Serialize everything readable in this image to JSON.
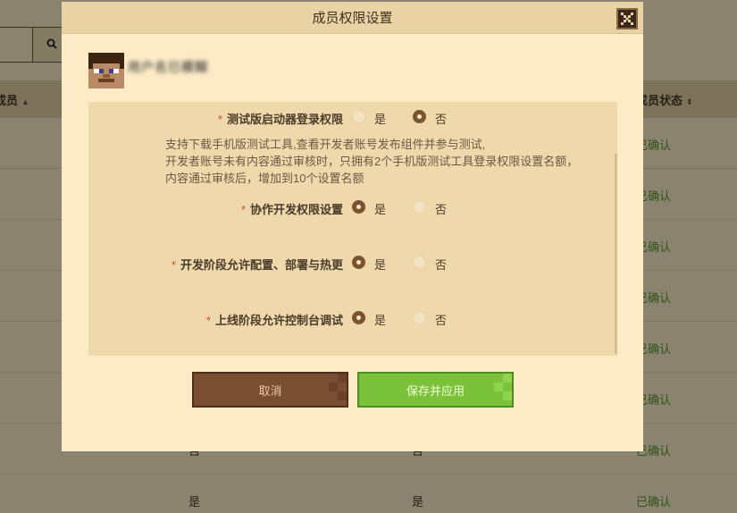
{
  "background": {
    "search_button_icon": "search-icon",
    "header_left": "成员",
    "header_right": "成员状态",
    "rows": [
      {
        "col1": "",
        "col2": "",
        "status": "已确认"
      },
      {
        "col1": "",
        "col2": "",
        "status": "已确认"
      },
      {
        "col1": "",
        "col2": "",
        "status": "已确认"
      },
      {
        "col1": "",
        "col2": "",
        "status": "已确认"
      },
      {
        "col1": "",
        "col2": "",
        "status": "已确认"
      },
      {
        "col1": "",
        "col2": "",
        "status": "已确认"
      },
      {
        "col1": "否",
        "col2": "否",
        "status": "已确认"
      },
      {
        "col1": "是",
        "col2": "是",
        "status": "已确认"
      }
    ]
  },
  "modal": {
    "title": "成员权限设置",
    "close_icon": "close-icon",
    "user": {
      "avatar_icon": "steve-avatar-icon",
      "name": "用户名已模糊"
    },
    "permissions": [
      {
        "required_mark": "*",
        "label": "测试版启动器登录权限",
        "yes_label": "是",
        "no_label": "否",
        "selected": "no",
        "description": [
          "支持下载手机版测试工具,查看开发者账号发布组件并参与测试,",
          "开发者账号未有内容通过审核时，只拥有2个手机版测试工具登录权限设置名额，",
          "内容通过审核后，增加到10个设置名额"
        ]
      },
      {
        "required_mark": "*",
        "label": "协作开发权限设置",
        "yes_label": "是",
        "no_label": "否",
        "selected": "yes"
      },
      {
        "required_mark": "*",
        "label": "开发阶段允许配置、部署与热更",
        "yes_label": "是",
        "no_label": "否",
        "selected": "yes"
      },
      {
        "required_mark": "*",
        "label": "上线阶段允许控制台调试",
        "yes_label": "是",
        "no_label": "否",
        "selected": "yes"
      }
    ],
    "buttons": {
      "cancel_label": "取消",
      "save_label": "保存并应用"
    }
  },
  "colors": {
    "modal_bg": "#fdebc7",
    "panel_bg": "#efd8ab",
    "cancel_button": "#7a4e32",
    "save_button": "#7ac23a",
    "required_mark": "#d44a3a",
    "confirmed_status": "#5b9a2a"
  }
}
